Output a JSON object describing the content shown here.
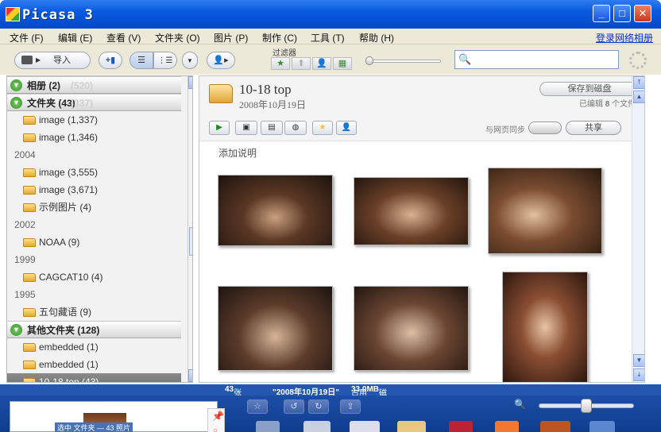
{
  "window": {
    "title": "Picasa 3",
    "controls": {
      "minimize": "_",
      "maximize": "□",
      "close": "✕"
    }
  },
  "menu": {
    "items": [
      "文件 (F)",
      "编辑 (E)",
      "查看 (V)",
      "文件夹 (O)",
      "图片 (P)",
      "制作 (C)",
      "工具 (T)",
      "帮助 (H)"
    ],
    "login_link": "登录网络相册"
  },
  "toolbar": {
    "import_label": "导入",
    "filter_label": "过滤器",
    "search_placeholder": ""
  },
  "sidebar": {
    "rows": [
      {
        "kind": "group",
        "label": "相册 (2)",
        "extra": "(520)"
      },
      {
        "kind": "group",
        "label": "文件夹 (43)",
        "extra": "(337)"
      },
      {
        "kind": "folder",
        "label": "image (1,337)"
      },
      {
        "kind": "folder",
        "label": "image (1,346)"
      },
      {
        "kind": "year",
        "label": "2004"
      },
      {
        "kind": "folder",
        "label": "image (3,555)"
      },
      {
        "kind": "folder",
        "label": "image (3,671)"
      },
      {
        "kind": "folder",
        "label": "示例图片 (4)"
      },
      {
        "kind": "year",
        "label": "2002"
      },
      {
        "kind": "folder",
        "label": "NOAA (9)"
      },
      {
        "kind": "year",
        "label": "1999"
      },
      {
        "kind": "folder",
        "label": "CAGCAT10 (4)"
      },
      {
        "kind": "year",
        "label": "1995"
      },
      {
        "kind": "folder",
        "label": "五句藏语 (9)"
      },
      {
        "kind": "group",
        "label": "其他文件夹 (128)",
        "extra": ""
      },
      {
        "kind": "folder",
        "label": "embedded (1)"
      },
      {
        "kind": "folder",
        "label": "embedded (1)"
      },
      {
        "kind": "folder",
        "label": "10-18 top (43)",
        "selected": true
      }
    ]
  },
  "album": {
    "title": "10-18 top",
    "date": "2008年10月19日",
    "save_to_disk": "保存到磁盘",
    "edit_count_prefix": "已编辑",
    "edit_count_value": "8",
    "edit_count_suffix": "个文件",
    "sync_label": "与网页同步",
    "share_label": "共享",
    "caption_prompt": "添加说明"
  },
  "status": {
    "count_value": "43",
    "count_suffix": "张图片",
    "date_quoted": "\"2008年10月19日\"",
    "disk_prefix": "占用",
    "disk_value": "33.0MB",
    "disk_suffix": "磁盘空间\""
  },
  "tray": {
    "caption": "选中 文件夹 — 43 照片"
  },
  "colors": {
    "titlebar": "#0a5ae0",
    "statusbar": "#2458b0",
    "tray": "#0f3c8e"
  }
}
